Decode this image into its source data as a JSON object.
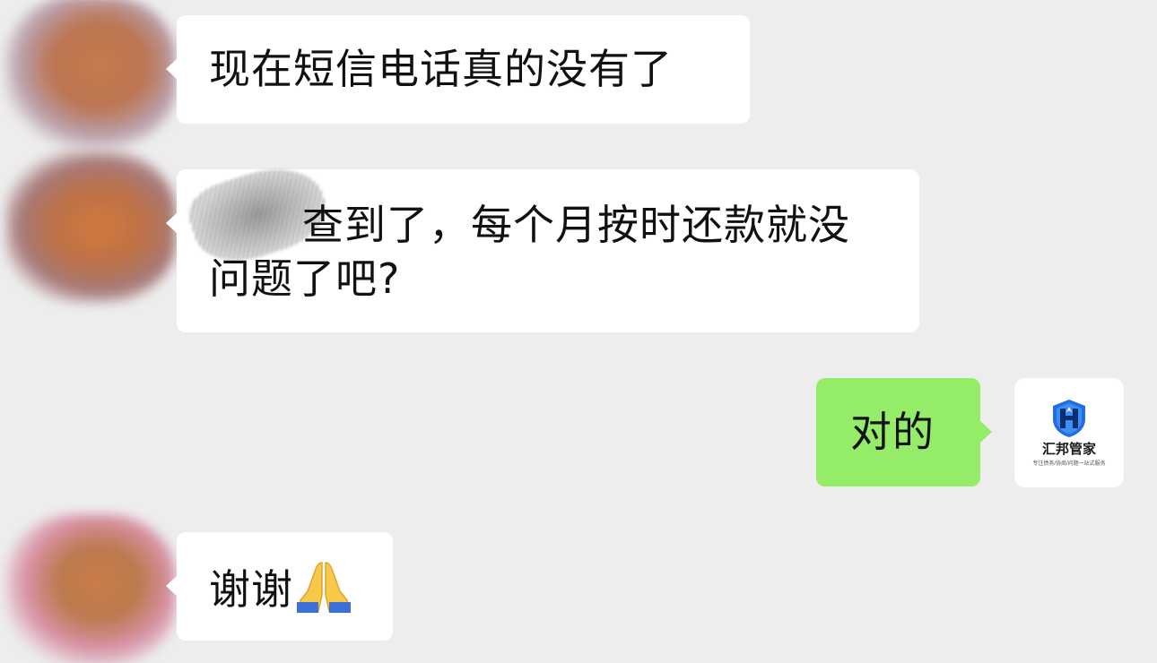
{
  "messages": [
    {
      "side": "left",
      "text": "现在短信电话真的没有了"
    },
    {
      "side": "left",
      "text_line1": "查到了，每个月按时还款就没",
      "text_line2": "问题了吧?"
    },
    {
      "side": "right",
      "text": "对的"
    },
    {
      "side": "left",
      "text": "谢谢"
    }
  ],
  "right_avatar": {
    "brand_name": "汇邦管家",
    "tagline": "专注债务/协商/问题一站式服务",
    "logo_icon": "shield-h-icon"
  },
  "colors": {
    "background": "#ededed",
    "incoming_bubble": "#ffffff",
    "outgoing_bubble": "#95ec69",
    "shield_blue": "#1f6fe0"
  },
  "icons": {
    "emoji": "folded-hands-icon"
  }
}
